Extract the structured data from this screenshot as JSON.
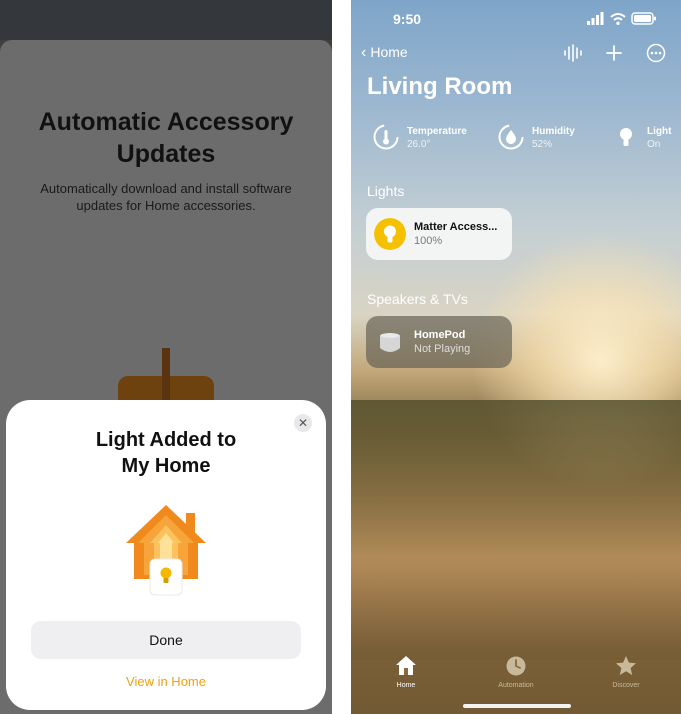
{
  "left": {
    "under_title": "Automatic Accessory Updates",
    "under_subtitle": "Automatically download and install software updates for Home accessories.",
    "sheet": {
      "title": "Light Added to My Home",
      "close_icon": "close-icon",
      "done_label": "Done",
      "view_label": "View in Home",
      "accent": "#f0a00e"
    }
  },
  "right": {
    "status": {
      "time": "9:50"
    },
    "nav": {
      "back_label": "Home"
    },
    "room_title": "Living Room",
    "stats": [
      {
        "label": "Temperature",
        "value": "26.0°"
      },
      {
        "label": "Humidity",
        "value": "52%"
      },
      {
        "label": "Light",
        "value": "On"
      }
    ],
    "sections": {
      "lights": "Lights",
      "speakers": "Speakers & TVs"
    },
    "tiles": {
      "light": {
        "title": "Matter Access...",
        "subtitle": "100%"
      },
      "homepod": {
        "title": "HomePod",
        "subtitle": "Not Playing"
      }
    },
    "tabs": [
      {
        "label": "Home",
        "icon": "house-icon",
        "active": true
      },
      {
        "label": "Automation",
        "icon": "clock-icon",
        "active": false
      },
      {
        "label": "Discover",
        "icon": "star-icon",
        "active": false
      }
    ]
  }
}
